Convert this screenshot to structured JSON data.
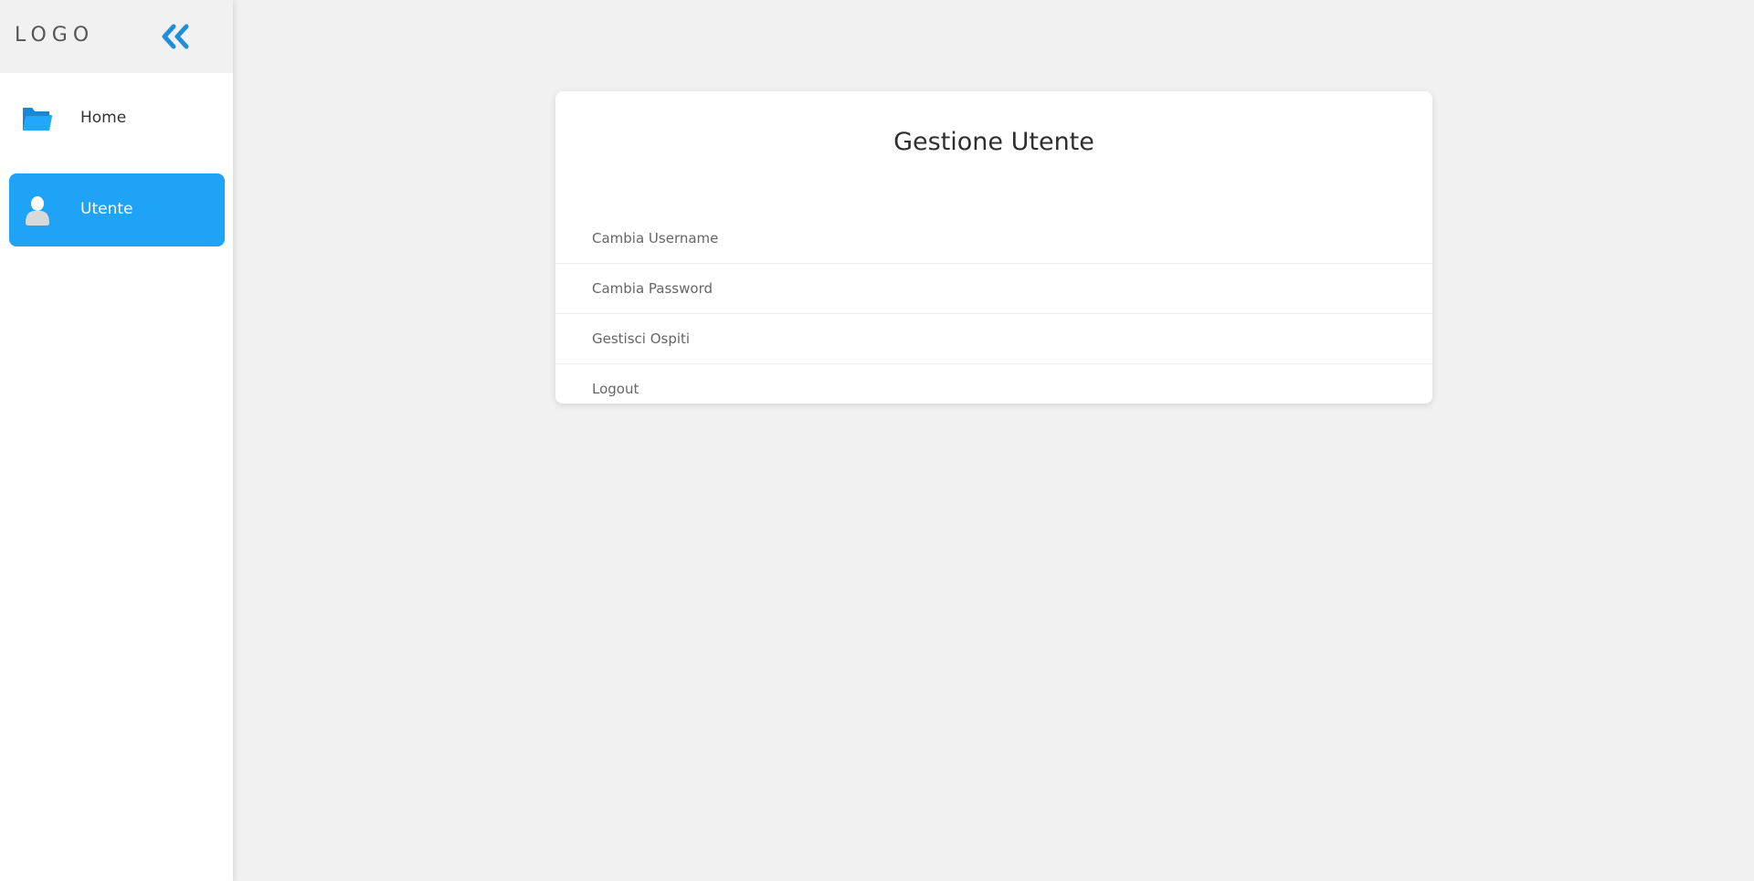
{
  "sidebar": {
    "logo": "LOGO",
    "collapse_icon": "double-chevron-left-icon",
    "items": [
      {
        "label": "Home",
        "icon": "folder-icon",
        "active": false
      },
      {
        "label": "Utente",
        "icon": "user-icon",
        "active": true
      }
    ]
  },
  "main": {
    "title": "Gestione Utente",
    "menu": [
      {
        "label": "Cambia Username"
      },
      {
        "label": "Cambia Password"
      },
      {
        "label": "Gestisci Ospiti"
      },
      {
        "label": "Logout"
      }
    ]
  },
  "colors": {
    "accent": "#1fa3f7",
    "background": "#f1f1f1",
    "card": "#ffffff"
  }
}
